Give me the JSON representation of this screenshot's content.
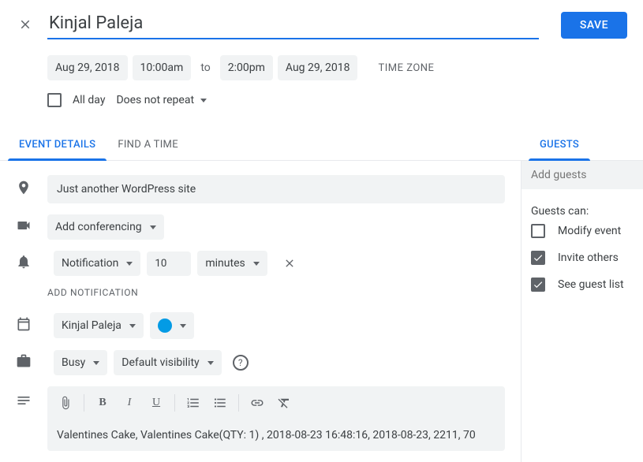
{
  "header": {
    "title_value": "Kinjal Paleja",
    "save_label": "SAVE"
  },
  "datetime": {
    "start_date": "Aug 29, 2018",
    "start_time": "10:00am",
    "to_label": "to",
    "end_time": "2:00pm",
    "end_date": "Aug 29, 2018",
    "timezone_label": "TIME ZONE"
  },
  "allday": {
    "checked": false,
    "label": "All day"
  },
  "repeat": {
    "label": "Does not repeat"
  },
  "tabs": {
    "event_details": "EVENT DETAILS",
    "find_time": "FIND A TIME",
    "guests": "GUESTS"
  },
  "location": {
    "value": "Just another WordPress site"
  },
  "conferencing": {
    "label": "Add conferencing"
  },
  "notification": {
    "type": "Notification",
    "amount": "10",
    "unit": "minutes",
    "add_label": "ADD NOTIFICATION"
  },
  "calendar": {
    "owner": "Kinjal Paleja",
    "color": "#039be5"
  },
  "availability": {
    "busy": "Busy",
    "visibility": "Default visibility"
  },
  "description": {
    "text": "Valentines Cake, Valentines Cake(QTY: 1) , 2018-08-23 16:48:16, 2018-08-23, 2211, 70"
  },
  "guests": {
    "placeholder": "Add guests",
    "can_label": "Guests can:",
    "modify": "Modify event",
    "invite": "Invite others",
    "seelist": "See guest list"
  }
}
